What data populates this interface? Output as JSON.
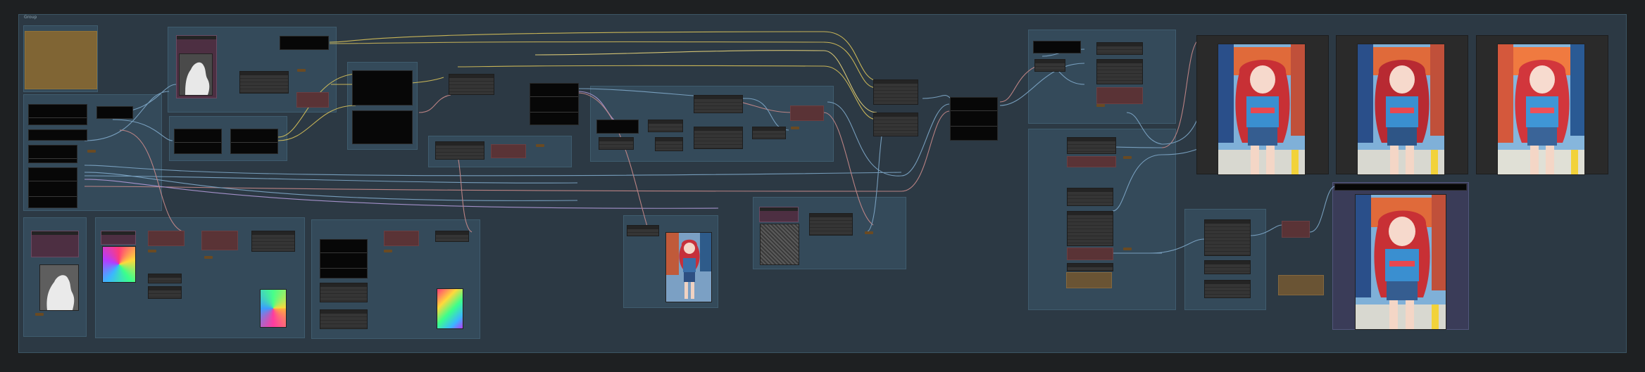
{
  "app": {
    "title": "Group",
    "colors": {
      "canvas_bg": "#1e2022",
      "group_bg": "#344a5a",
      "node_bg": "#353535",
      "node_red": "#5a3336",
      "node_gold": "#6a5434",
      "link_yellow": "#d8c25a",
      "link_blue": "#7fa8c8",
      "link_pink": "#c98a8a",
      "link_purple": "#b09ad8"
    }
  },
  "previews": {
    "icons": [
      "anime-girl-image-icon",
      "checkerboard-mask-icon",
      "noise-latent-icon",
      "white-mask-icon"
    ]
  }
}
